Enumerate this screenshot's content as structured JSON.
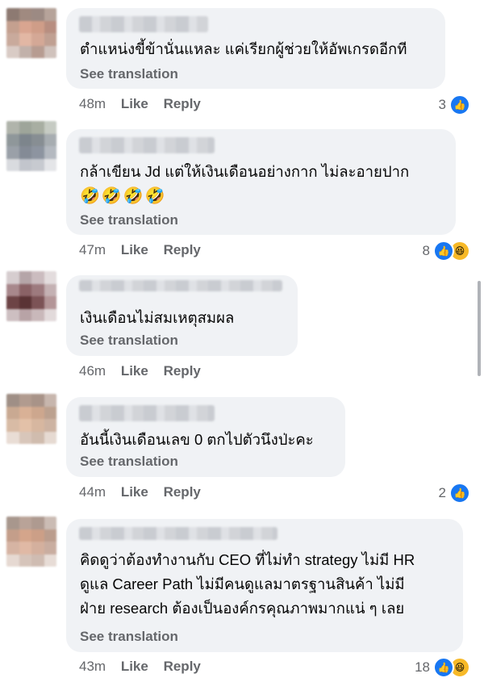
{
  "colors": {
    "bubble": "#f0f2f5",
    "meta": "#65676b",
    "like_blue": "#1877f2",
    "haha_yellow": "#f7b928"
  },
  "comments": [
    {
      "text": "ตำแหน่งขี้ข้านั่นแหละ แค่เรียกผู้ช่วยให้อัพเกรดอีกที",
      "see_translation": "See translation",
      "time": "48m",
      "like": "Like",
      "reply": "Reply",
      "reaction_count": "3",
      "reactions": [
        "like-icon"
      ]
    },
    {
      "text": "กล้าเขียน Jd  แต่ให้เงินเดือนอย่างกาก ไม่ละอายปาก",
      "emoji": "🤣🤣🤣🤣",
      "see_translation": "See translation",
      "time": "47m",
      "like": "Like",
      "reply": "Reply",
      "reaction_count": "8",
      "reactions": [
        "like-icon",
        "haha-icon"
      ]
    },
    {
      "text": "เงินเดือนไม่สมเหตุสมผล",
      "see_translation": "See translation",
      "time": "46m",
      "like": "Like",
      "reply": "Reply",
      "reaction_count": "",
      "reactions": []
    },
    {
      "text": "อันนี้เงินเดือนเลข 0 ตกไปตัวนึงป่ะคะ",
      "see_translation": "See translation",
      "time": "44m",
      "like": "Like",
      "reply": "Reply",
      "reaction_count": "2",
      "reactions": [
        "like-icon"
      ]
    },
    {
      "text": "คิดดูว่าต้องทำงานกับ CEO ที่ไม่ทำ strategy ไม่มี HR\nดูแล Career Path ไม่มีคนดูแลมาตรฐานสินค้า ไม่มี\nฝ่าย research ต้องเป็นองค์กรคุณภาพมากแน่ ๆ เลย",
      "see_translation": "See translation",
      "time": "43m",
      "like": "Like",
      "reply": "Reply",
      "reaction_count": "18",
      "reactions": [
        "like-icon",
        "haha-icon"
      ]
    }
  ]
}
